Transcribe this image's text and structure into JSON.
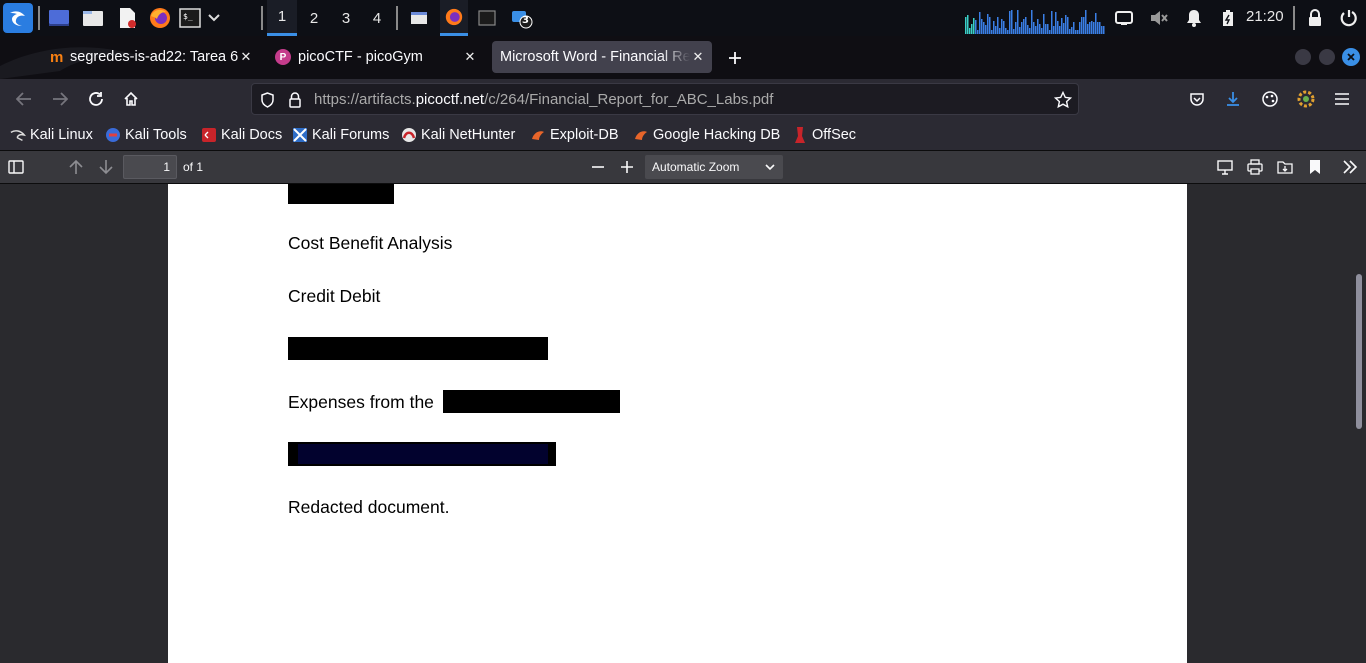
{
  "taskbar": {
    "workspaces": [
      "1",
      "2",
      "3",
      "4"
    ],
    "active_workspace": "1",
    "clock": "21:20",
    "notification_badge": "3",
    "icons": [
      "kali-menu-icon",
      "desktop-icon",
      "file-manager-icon",
      "text-editor-icon",
      "firefox-icon",
      "terminal-icon",
      "chevron-down-icon",
      "window-icon",
      "firefox-window-icon",
      "terminal-window-icon",
      "notification-app-icon",
      "cpu-graph",
      "display-icon",
      "mute-icon",
      "bell-icon",
      "battery-icon",
      "lock-icon",
      "power-icon"
    ]
  },
  "tabs": [
    {
      "title": "segredes-is-ad22: Tarea 6",
      "icon": "moodle-icon",
      "selected": false
    },
    {
      "title": "picoCTF - picoGym",
      "icon": "picoctf-icon",
      "selected": false
    },
    {
      "title": "Microsoft Word - Financial Report for ABC Labs",
      "icon": "",
      "selected": true
    }
  ],
  "navbar": {
    "url_prefix": "https://artifacts.",
    "url_host": "picoctf.net",
    "url_path": "/c/264/Financial_Report_for_ABC_Labs.pdf"
  },
  "bookmarks": [
    {
      "label": "Kali Linux",
      "icon": "kali-icon"
    },
    {
      "label": "Kali Tools",
      "icon": "kali-tools-icon"
    },
    {
      "label": "Kali Docs",
      "icon": "kali-docs-icon"
    },
    {
      "label": "Kali Forums",
      "icon": "kali-forums-icon"
    },
    {
      "label": "Kali NetHunter",
      "icon": "nethunter-icon"
    },
    {
      "label": "Exploit-DB",
      "icon": "exploitdb-icon"
    },
    {
      "label": "Google Hacking DB",
      "icon": "ghdb-icon"
    },
    {
      "label": "OffSec",
      "icon": "offsec-icon"
    }
  ],
  "pdf_toolbar": {
    "page_number": "1",
    "page_count": "of 1",
    "zoom": "Automatic Zoom"
  },
  "document": {
    "lines": [
      "Cost Benefit Analysis",
      "Credit Debit",
      "Expenses from the",
      "Redacted document."
    ]
  },
  "colors": {
    "taskbar_bg": "#0d0f15",
    "tabstrip_bg": "#0f0e13",
    "toolbar_bg": "#2b2a33",
    "pdf_toolbar_bg": "#38383d",
    "viewer_bg": "#2a2a2e",
    "accent": "#3a8fe6",
    "redaction": "#000000",
    "redaction_navy": "#02022e"
  }
}
